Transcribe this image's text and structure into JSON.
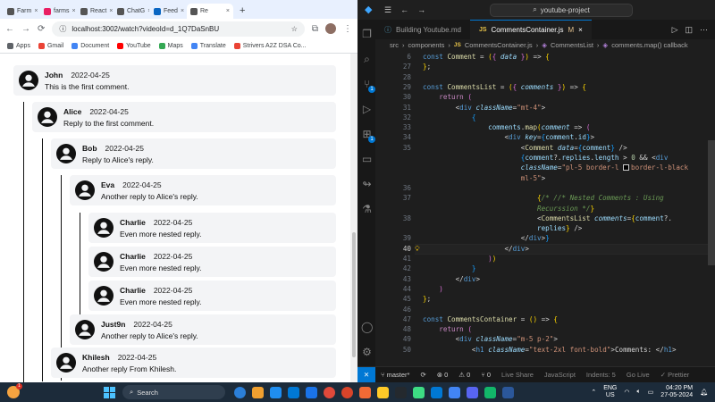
{
  "browser": {
    "tabs": [
      {
        "label": "Farm",
        "color": "#555555",
        "active": false
      },
      {
        "label": "farms",
        "color": "#e91e63",
        "active": false
      },
      {
        "label": "React",
        "color": "#555555",
        "active": false
      },
      {
        "label": "ChatG",
        "color": "#555555",
        "active": false
      },
      {
        "label": "Feed",
        "color": "#0a66c2",
        "active": false
      },
      {
        "label": "Re",
        "color": "#555555",
        "active": true
      }
    ],
    "newtab_label": "+",
    "url": "localhost:3002/watch?videoId=d_1Q7DaSnBU",
    "bookmarks": [
      {
        "label": "Apps",
        "color": "#5f6368"
      },
      {
        "label": "Gmail",
        "color": "#ea4335"
      },
      {
        "label": "Document",
        "color": "#4285f4"
      },
      {
        "label": "YouTube",
        "color": "#ff0000"
      },
      {
        "label": "Maps",
        "color": "#34a853"
      },
      {
        "label": "Translate",
        "color": "#4285f4"
      },
      {
        "label": "Strivers A2Z DSA Co...",
        "color": "#ea4335"
      }
    ],
    "comments": [
      {
        "name": "John",
        "date": "2022-04-25",
        "text": "This is the first comment."
      },
      {
        "name": "Alice",
        "date": "2022-04-25",
        "text": "Reply to the first comment."
      },
      {
        "name": "Bob",
        "date": "2022-04-25",
        "text": "Reply to Alice's reply."
      },
      {
        "name": "Eva",
        "date": "2022-04-25",
        "text": "Another reply to Alice's reply."
      },
      {
        "name": "Charlie",
        "date": "2022-04-25",
        "text": "Even more nested reply."
      },
      {
        "name": "Charlie",
        "date": "2022-04-25",
        "text": "Even more nested reply."
      },
      {
        "name": "Charlie",
        "date": "2022-04-25",
        "text": "Even more nested reply."
      },
      {
        "name": "Just9n",
        "date": "2022-04-25",
        "text": "Another reply to Alice's reply."
      },
      {
        "name": "Khilesh",
        "date": "2022-04-25",
        "text": "Another reply From Khilesh."
      }
    ]
  },
  "vscode": {
    "search_text": "youtube-project",
    "tabs": [
      {
        "label": "Building Youtube.md",
        "icon": "",
        "modified": "",
        "active": false
      },
      {
        "label": "CommentsContainer.js",
        "icon": "JS",
        "modified": "M",
        "active": true
      }
    ],
    "breadcrumb": [
      "src",
      "components",
      "CommentsContainer.js",
      "CommentsList",
      "comments.map() callback"
    ],
    "breadcrumb_js": "JS",
    "status": {
      "branch": "master*",
      "sync": "⟳",
      "errors": "⊗ 0",
      "warnings": "⚠ 0",
      "ports": "⑂ 0",
      "live_share": "Live Share",
      "language": "JavaScript",
      "indent": "Indents: 5",
      "golive": "Go Live",
      "prettier": "✓ Prettier"
    },
    "lines": [
      {
        "n": "6",
        "html": "<span class=\"kw\">const</span> <span class=\"fn2\">Comment</span> = <span class=\"brk\">(</span><span class=\"brk2\">{</span> <span class=\"var it\">data</span> <span class=\"brk2\">}</span><span class=\"brk\">)</span> => <span class=\"brk\">{</span>"
      },
      {
        "n": "27",
        "html": "<span class=\"brk\">}</span>;"
      },
      {
        "n": "28",
        "html": ""
      },
      {
        "n": "29",
        "html": "<span class=\"kw\">const</span> <span class=\"fn2\">CommentsList</span> = <span class=\"brk\">(</span><span class=\"brk2\">{</span> <span class=\"var it\">comments</span> <span class=\"brk2\">}</span><span class=\"brk\">)</span> => <span class=\"brk\">{</span>"
      },
      {
        "n": "30",
        "html": "    <span class=\"ctl\">return</span> <span class=\"brk2\">(</span>"
      },
      {
        "n": "31",
        "html": "        <span class=\"plain\">&lt;</span><span class=\"tag\">div</span> <span class=\"attr it\">className</span>=<span class=\"str\">\"mt-4\"</span><span class=\"plain\">&gt;</span>"
      },
      {
        "n": "32",
        "html": "            <span class=\"brk3\">{</span>"
      },
      {
        "n": "33",
        "html": "                <span class=\"var\">comments</span>.<span class=\"fn2\">map</span><span class=\"brk\">(</span><span class=\"var it\">comment</span> => <span class=\"brk2\">(</span>"
      },
      {
        "n": "34",
        "html": "                    <span class=\"plain\">&lt;</span><span class=\"tag\">div</span> <span class=\"attr it\">key</span>=<span class=\"brk3\">{</span><span class=\"var\">comment</span>.<span class=\"var\">id</span><span class=\"brk3\">}</span><span class=\"plain\">&gt;</span>"
      },
      {
        "n": "35",
        "html": "                        <span class=\"plain\">&lt;</span><span class=\"fn2\">Comment</span> <span class=\"attr it\">data</span>=<span class=\"brk3\">{</span><span class=\"var\">comment</span><span class=\"brk3\">}</span> <span class=\"plain\">/&gt;</span>"
      },
      {
        "n": "",
        "html": "                        <span class=\"brk3\">{</span><span class=\"var\">comment</span>?.<span class=\"var\">replies</span>.<span class=\"var\">length</span> > <span class=\"num\">0</span> && <span class=\"plain\">&lt;</span><span class=\"tag\">div</span>"
      },
      {
        "n": "",
        "html": "                        <span class=\"attr it\">className</span>=<span class=\"str\">\"pl-5 border-l <span class=\"colorbox\"></span>border-l-black</span>"
      },
      {
        "n": "",
        "html": "<span class=\"str\">                        ml-5\"</span><span class=\"plain\">&gt;</span>"
      },
      {
        "n": "36",
        "html": ""
      },
      {
        "n": "37",
        "html": "                            <span class=\"brk\">{</span><span class=\"cmt it\">/* //* Nested Comments : Using</span>"
      },
      {
        "n": "",
        "html": "<span class=\"cmt it\">                            Recurssion */</span><span class=\"brk\">}</span>"
      },
      {
        "n": "38",
        "html": "                            <span class=\"plain\">&lt;</span><span class=\"fn2\">CommentsList</span> <span class=\"attr it\">comments</span>=<span class=\"brk\">{</span><span class=\"var\">comment</span>?."
      },
      {
        "n": "",
        "html": "                            <span class=\"var\">replies</span><span class=\"brk\">}</span> <span class=\"plain\">/&gt;</span>"
      },
      {
        "n": "39",
        "html": "                        <span class=\"plain\">&lt;/</span><span class=\"tag\">div</span><span class=\"plain\">&gt;</span><span class=\"brk3\">}</span>"
      },
      {
        "n": "40",
        "html": "                    <span class=\"plain\">&lt;/</span><span class=\"tag\">div</span><span class=\"plain\">&gt;</span>"
      },
      {
        "n": "41",
        "html": "                <span class=\"brk2\">)</span><span class=\"brk\">)</span>"
      },
      {
        "n": "42",
        "html": "            <span class=\"brk3\">}</span>"
      },
      {
        "n": "43",
        "html": "        <span class=\"plain\">&lt;/</span><span class=\"tag\">div</span><span class=\"plain\">&gt;</span>"
      },
      {
        "n": "44",
        "html": "    <span class=\"brk2\">)</span>"
      },
      {
        "n": "45",
        "html": "<span class=\"brk\">}</span>;"
      },
      {
        "n": "46",
        "html": ""
      },
      {
        "n": "47",
        "html": "<span class=\"kw\">const</span> <span class=\"fn2\">CommentsContainer</span> = <span class=\"brk\">()</span> => <span class=\"brk\">{</span>"
      },
      {
        "n": "48",
        "html": "    <span class=\"ctl\">return</span> <span class=\"brk2\">(</span>"
      },
      {
        "n": "49",
        "html": "        <span class=\"plain\">&lt;</span><span class=\"tag\">div</span> <span class=\"attr it\">className</span>=<span class=\"str\">\"m-5 p-2\"</span><span class=\"plain\">&gt;</span>"
      },
      {
        "n": "50",
        "html": "            <span class=\"plain\">&lt;</span><span class=\"tag\">h1</span> <span class=\"attr it\">className</span>=<span class=\"str\">\"text-2xl font-bold\"</span><span class=\"plain\">&gt;</span>Comments: <span class=\"plain\">&lt;/</span><span class=\"tag\">h1</span><span class=\"plain\">&gt;</span>"
      }
    ]
  },
  "taskbar": {
    "search_placeholder": "Search",
    "weather_badge": "1",
    "lang": "ENG",
    "region": "US",
    "time": "04:20 PM",
    "date": "27-05-2024",
    "apps": [
      "#2b7fd8",
      "#f0a030",
      "#1f8ef1",
      "#0078d4",
      "#1a73e8",
      "#e0493a",
      "#d9442a",
      "#f06a35",
      "#ffca28",
      "#24292e",
      "#3ddc84",
      "#0078d4",
      "#4285f4",
      "#5865f2",
      "#12b76a",
      "#2b579a"
    ]
  }
}
